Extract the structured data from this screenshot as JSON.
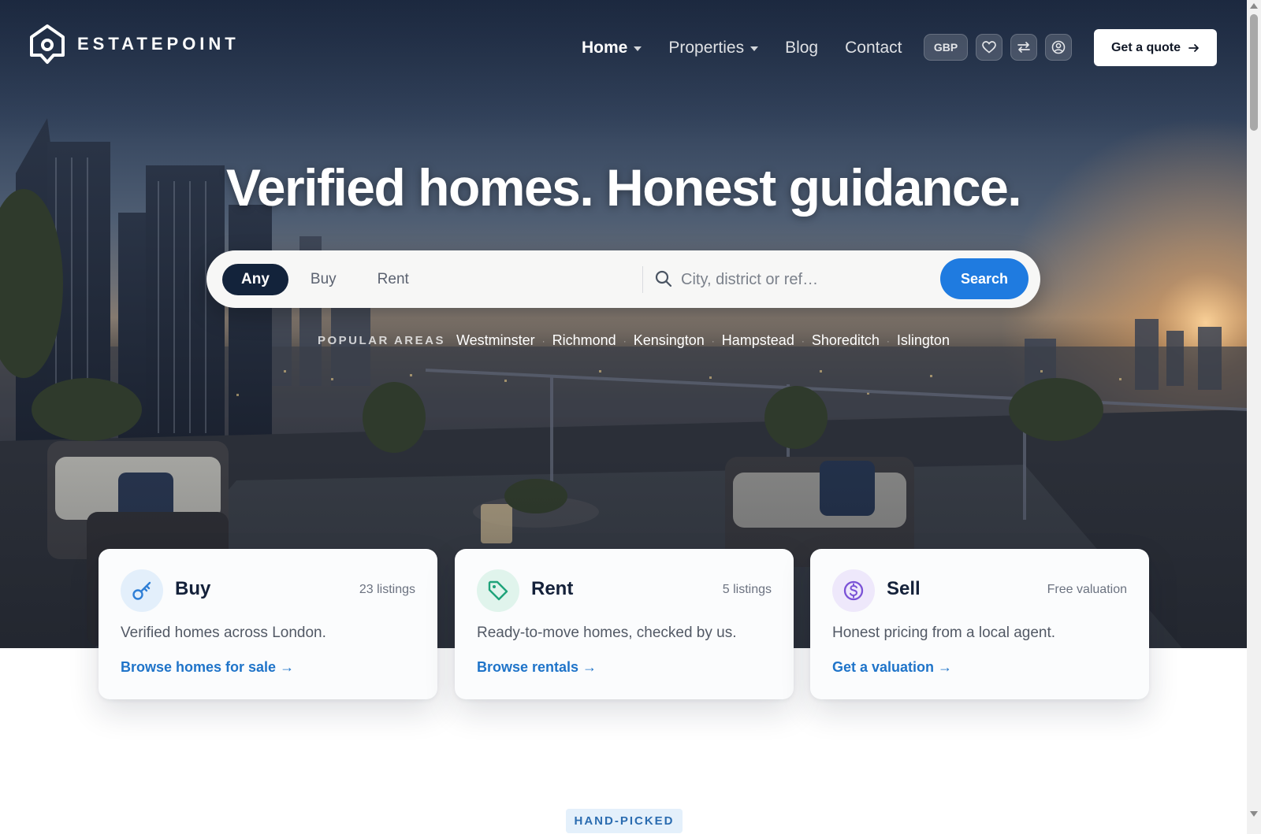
{
  "brand": {
    "name": "ESTATEPOINT"
  },
  "nav": {
    "items": [
      {
        "label": "Home",
        "active": true,
        "has_dropdown": true
      },
      {
        "label": "Properties",
        "active": false,
        "has_dropdown": true
      },
      {
        "label": "Blog",
        "active": false,
        "has_dropdown": false
      },
      {
        "label": "Contact",
        "active": false,
        "has_dropdown": false
      }
    ],
    "currency": "GBP",
    "tool_icons": [
      "heart-icon",
      "compare-arrows-icon",
      "user-icon"
    ],
    "quote_label": "Get a quote"
  },
  "hero": {
    "headline": "Verified homes. Honest guidance."
  },
  "search": {
    "segments": [
      {
        "label": "Any",
        "active": true
      },
      {
        "label": "Buy",
        "active": false
      },
      {
        "label": "Rent",
        "active": false
      }
    ],
    "placeholder": "City, district or ref…",
    "value": "",
    "button_label": "Search"
  },
  "popular_areas": {
    "label": "POPULAR AREAS",
    "areas": [
      "Westminster",
      "Richmond",
      "Kensington",
      "Hampstead",
      "Shoreditch",
      "Islington"
    ]
  },
  "cards": [
    {
      "title": "Buy",
      "meta": "23 listings",
      "description": "Verified homes across London.",
      "link": "Browse homes for sale →",
      "icon": "key-icon",
      "accent": "#2f7fd6",
      "icon_bg": "#e3effb"
    },
    {
      "title": "Rent",
      "meta": "5 listings",
      "description": "Ready-to-move homes, checked by us.",
      "link": "Browse rentals →",
      "icon": "tag-icon",
      "accent": "#1fa37a",
      "icon_bg": "#e0f4ec"
    },
    {
      "title": "Sell",
      "meta": "Free valuation",
      "description": "Honest pricing from a local agent.",
      "link": "Get a valuation →",
      "icon": "coin-icon",
      "accent": "#7a52d6",
      "icon_bg": "#eee8fb"
    }
  ],
  "section": {
    "eyebrow": "HAND-PICKED"
  },
  "colors": {
    "primary": "#1f7be0",
    "navy": "#13233b",
    "link": "#1f74c9"
  }
}
